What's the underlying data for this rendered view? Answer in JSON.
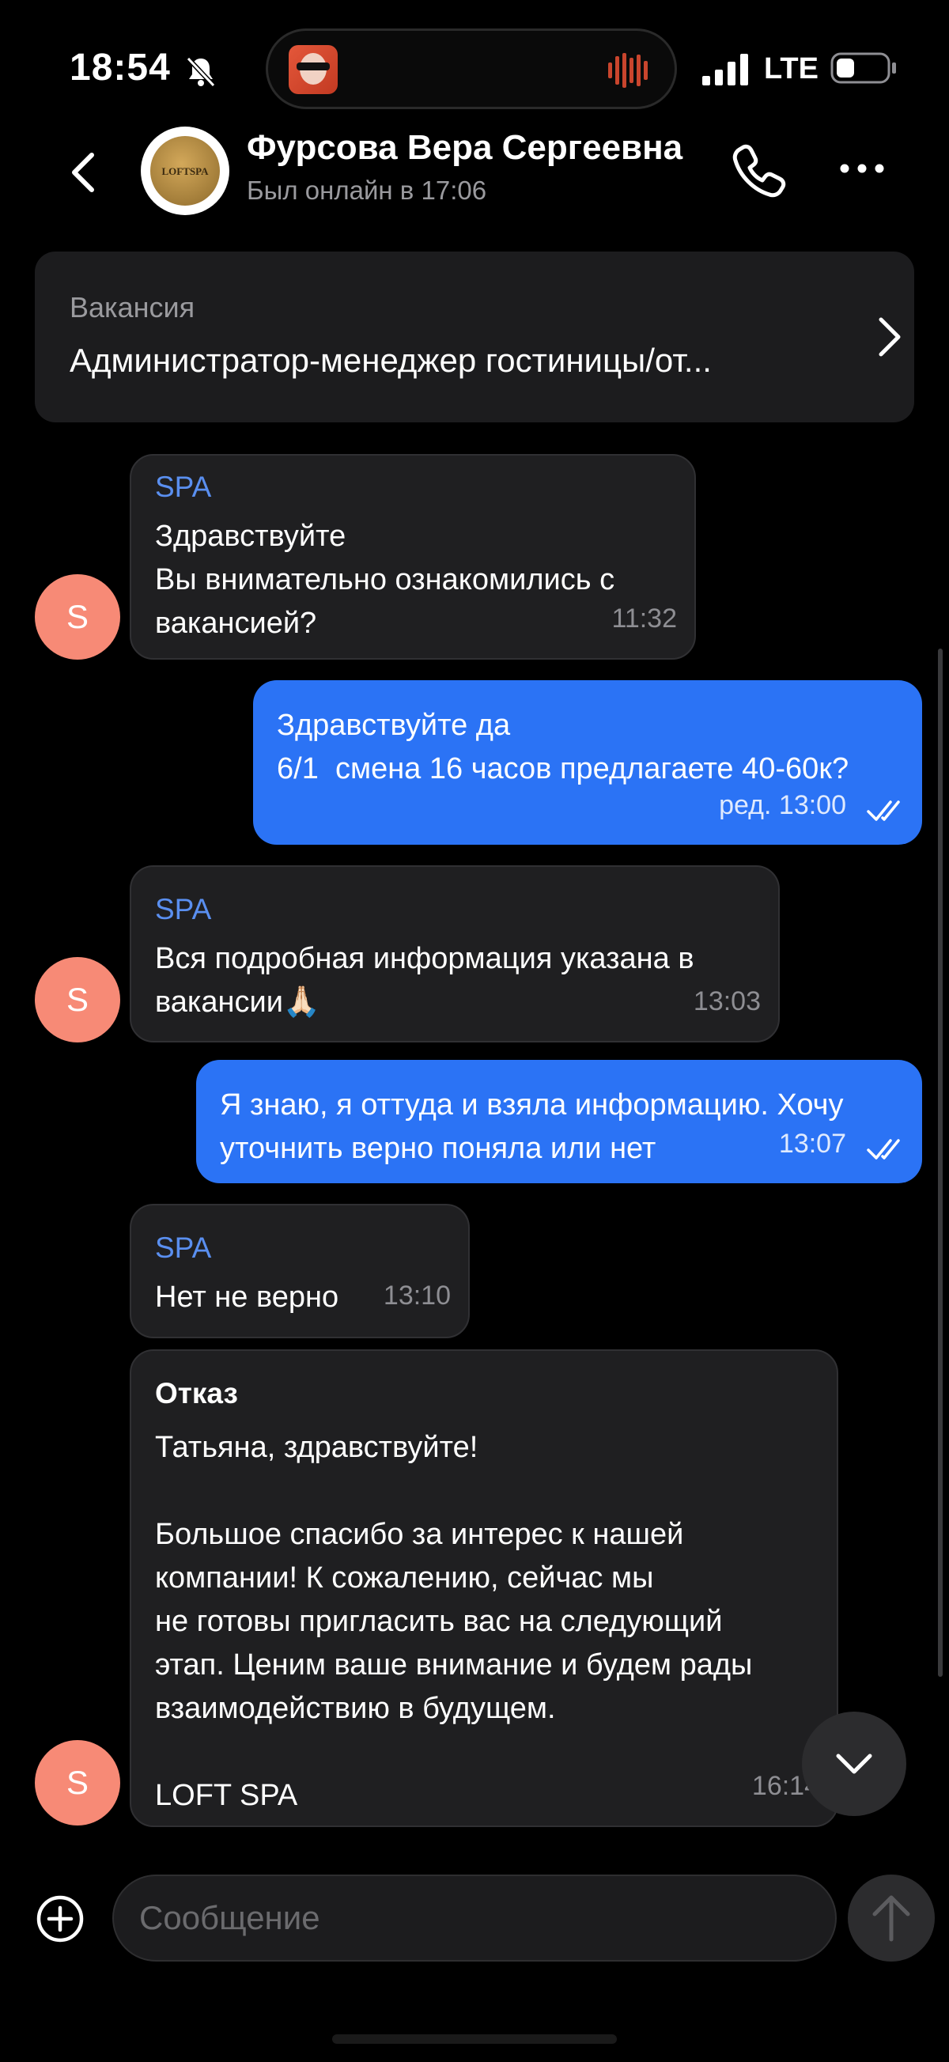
{
  "status_bar": {
    "time": "18:54",
    "network": "LTE"
  },
  "header": {
    "avatar_text": "LOFTSPA",
    "contact_name": "Фурсова Вера Сергеевна",
    "contact_status": "Был онлайн в 17:06"
  },
  "vacancy": {
    "label": "Вакансия",
    "title": "Администратор-менеджер гостиницы/от..."
  },
  "messages": [
    {
      "direction": "in",
      "sender": "SPA",
      "text": "Здравствуйте\nВы внимательно ознакомились с\nвакансией?",
      "time": "11:32",
      "avatar": "S"
    },
    {
      "direction": "out",
      "text": "Здравствуйте да\n6/1  смена 16 часов предлагаете 40-60к?",
      "time": "ред. 13:00"
    },
    {
      "direction": "in",
      "sender": "SPA",
      "text": "Вся подробная информация указана в\nвакансии🙏🏻",
      "time": "13:03",
      "avatar": "S"
    },
    {
      "direction": "out",
      "text": "Я знаю, я оттуда и взяла информацию. Хочу\nуточнить верно поняла или нет",
      "time": "13:07"
    },
    {
      "direction": "in",
      "sender": "SPA",
      "text": "Нет не верно",
      "time": "13:10"
    },
    {
      "direction": "in",
      "title": "Отказ",
      "text": "Татьяна, здравствуйте!\n\nБольшое спасибо за интерес к нашей\nкомпании! К сожалению, сейчас мы\nне готовы пригласить вас на следующий\nэтап. Ценим ваше внимание и будем рады\nвзаимодействию в будущем.\n\nLOFT SPA",
      "time": "16:14",
      "avatar": "S"
    }
  ],
  "composer": {
    "placeholder": "Сообщение"
  },
  "colors": {
    "background": "#000000",
    "incoming_bubble": "#1f1f21",
    "outgoing_bubble": "#2b73f5",
    "sender_name": "#5a8ff0",
    "avatar": "#f78a76"
  },
  "icons": [
    "bell-muted-icon",
    "signal-icon",
    "battery-icon",
    "back-chevron-icon",
    "phone-icon",
    "more-dots-icon",
    "chevron-right-icon",
    "double-check-icon",
    "chevron-down-icon",
    "plus-circle-icon",
    "arrow-up-icon"
  ]
}
